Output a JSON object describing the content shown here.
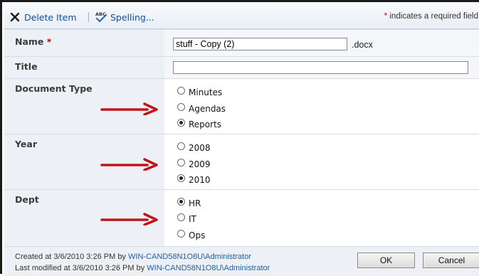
{
  "toolbar": {
    "delete_label": "Delete Item",
    "spelling_label": "Spelling...",
    "required_star": "*",
    "required_note": "indicates a required field"
  },
  "fields": {
    "name": {
      "label": "Name",
      "required_star": "*",
      "value": "stuff - Copy (2)",
      "extension": ".docx"
    },
    "title": {
      "label": "Title",
      "value": ""
    },
    "document_type": {
      "label": "Document Type",
      "options": [
        "Minutes",
        "Agendas",
        "Reports"
      ],
      "selected": "Reports"
    },
    "year": {
      "label": "Year",
      "options": [
        "2008",
        "2009",
        "2010"
      ],
      "selected": "2010"
    },
    "dept": {
      "label": "Dept",
      "options": [
        "HR",
        "IT",
        "Ops"
      ],
      "selected": "HR"
    }
  },
  "footer": {
    "created_prefix": "Created at 3/6/2010 3:26 PM  by",
    "created_user": "WIN-CAND58N1O8U\\Administrator",
    "modified_prefix": "Last modified at 3/6/2010 3:26 PM  by",
    "modified_user": "WIN-CAND58N1O8U\\Administrator",
    "ok_label": "OK",
    "cancel_label": "Cancel"
  },
  "colors": {
    "arrow": "#c0161a",
    "link": "#0d4f9e",
    "required": "#c00000"
  },
  "icons": [
    "delete-x-icon",
    "spelling-abc-icon",
    "red-arrow-icon"
  ]
}
